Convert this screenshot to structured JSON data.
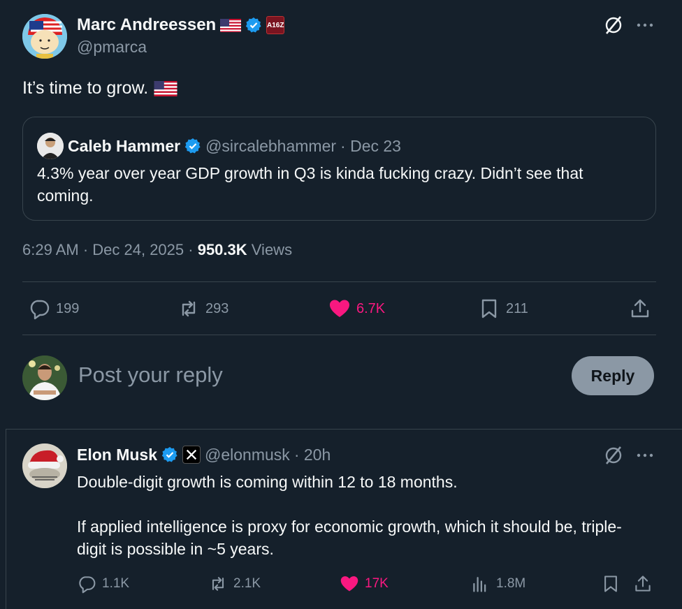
{
  "tweet": {
    "author_name": "Marc Andreessen",
    "author_handle": "@pmarca",
    "affiliate_badge": "A16Z",
    "text": "It’s time to grow.",
    "quote": {
      "author_name": "Caleb Hammer",
      "author_handle": "@sircalebhammer",
      "date": "· Dec 23",
      "text": "4.3% year over year GDP growth in Q3 is kinda fucking crazy. Didn’t see that coming."
    },
    "time": "6:29 AM · Dec 24, 2025 ·",
    "views_count": "950.3K",
    "views_label": "Views",
    "actions": {
      "replies": "199",
      "reposts": "293",
      "likes": "6.7K",
      "bookmarks": "211"
    }
  },
  "reply_box": {
    "placeholder": "Post your reply",
    "button_label": "Reply"
  },
  "reply_tweet": {
    "author_name": "Elon Musk",
    "author_handle": "@elonmusk",
    "time": "· 20h",
    "paragraphs": [
      "Double-digit growth is coming within 12 to 18 months.",
      "If applied intelligence is proxy for economic growth, which it should be, triple-digit is possible in ~5 years."
    ],
    "actions": {
      "replies": "1.1K",
      "reposts": "2.1K",
      "likes": "17K",
      "views": "1.8M"
    }
  },
  "colors": {
    "background": "#15202b",
    "text": "#f7f9f9",
    "muted": "#8b98a5",
    "like": "#f91880",
    "verified": "#1d9bf0",
    "border": "#38444d"
  },
  "icons": [
    "verified-icon",
    "us-flag-icon",
    "grok-icon",
    "more-icon",
    "reply-icon",
    "repost-icon",
    "like-icon",
    "bookmark-icon",
    "share-icon",
    "views-icon",
    "x-logo-icon"
  ]
}
